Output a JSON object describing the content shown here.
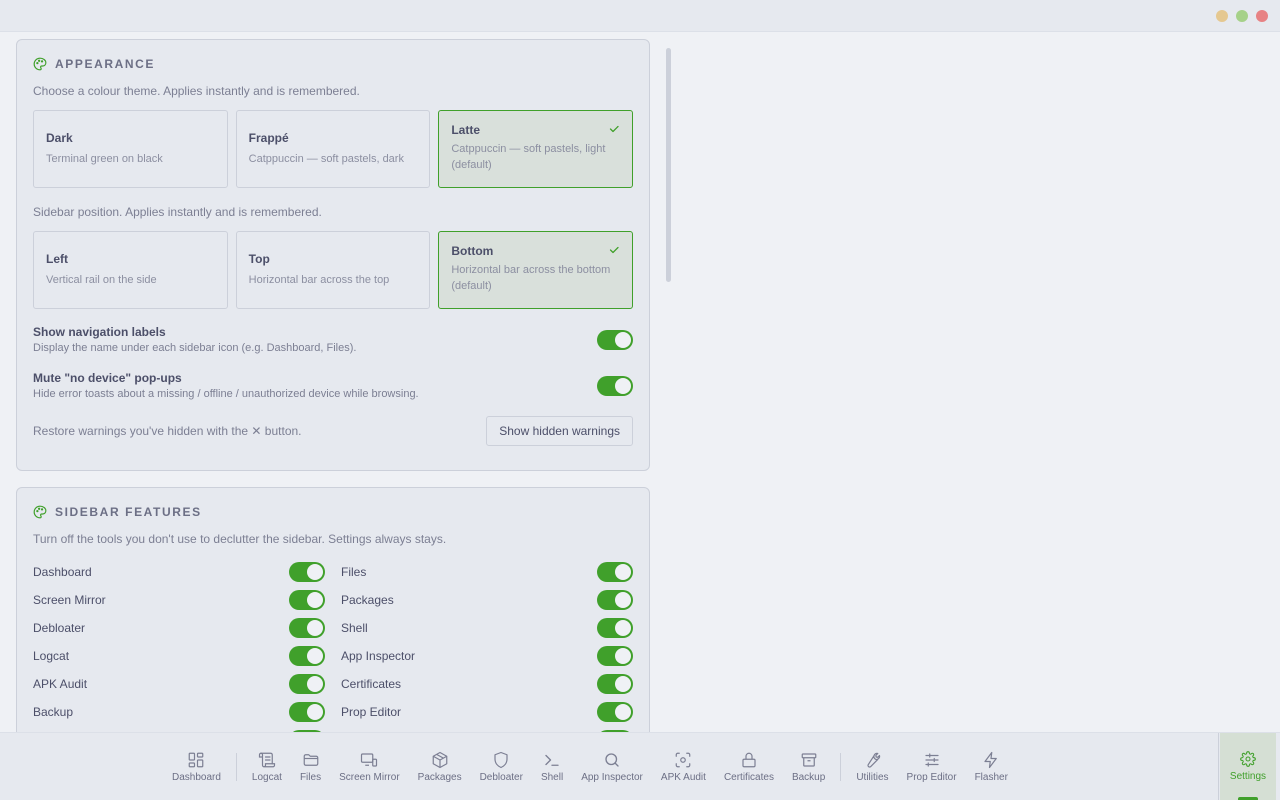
{
  "window_controls": {
    "colors": [
      "#e5c890",
      "#a6d189",
      "#e78284"
    ]
  },
  "colors": {
    "accent": "#40a02b",
    "background": "#eff1f5",
    "card": "#e6e9ef"
  },
  "appearance": {
    "title": "APPEARANCE",
    "icon": "palette-icon",
    "theme_desc": "Choose a colour theme. Applies instantly and is remembered.",
    "themes": [
      {
        "title": "Dark",
        "sub": "Terminal green on black",
        "selected": false
      },
      {
        "title": "Frappé",
        "sub": "Catppuccin — soft pastels, dark",
        "selected": false
      },
      {
        "title": "Latte",
        "sub": "Catppuccin — soft pastels, light (default)",
        "selected": true
      }
    ],
    "sidebar_desc": "Sidebar position. Applies instantly and is remembered.",
    "positions": [
      {
        "title": "Left",
        "sub": "Vertical rail on the side",
        "selected": false
      },
      {
        "title": "Top",
        "sub": "Horizontal bar across the top",
        "selected": false
      },
      {
        "title": "Bottom",
        "sub": "Horizontal bar across the bottom (default)",
        "selected": true
      }
    ],
    "nav_labels": {
      "title": "Show navigation labels",
      "sub": "Display the name under each sidebar icon (e.g. Dashboard, Files).",
      "on": true
    },
    "mute_popups": {
      "title": "Mute \"no device\" pop-ups",
      "sub": "Hide error toasts about a missing / offline / unauthorized device while browsing.",
      "on": true
    },
    "restore_text": "Restore warnings you've hidden with the ✕ button.",
    "restore_button": "Show hidden warnings"
  },
  "sidebar_features": {
    "title": "SIDEBAR FEATURES",
    "icon": "palette-icon",
    "desc": "Turn off the tools you don't use to declutter the sidebar. Settings always stays.",
    "left": [
      {
        "label": "Dashboard",
        "on": true
      },
      {
        "label": "Screen Mirror",
        "on": true
      },
      {
        "label": "Debloater",
        "on": true
      },
      {
        "label": "Logcat",
        "on": true
      },
      {
        "label": "APK Audit",
        "on": true
      },
      {
        "label": "Backup",
        "on": true
      }
    ],
    "right": [
      {
        "label": "Files",
        "on": true
      },
      {
        "label": "Packages",
        "on": true
      },
      {
        "label": "Shell",
        "on": true
      },
      {
        "label": "App Inspector",
        "on": true
      },
      {
        "label": "Certificates",
        "on": true
      },
      {
        "label": "Prop Editor",
        "on": true
      }
    ]
  },
  "nav": {
    "items": [
      {
        "label": "Dashboard",
        "icon": "dashboard-icon"
      },
      {
        "label": "Logcat",
        "icon": "scroll-icon"
      },
      {
        "label": "Files",
        "icon": "folder-icon"
      },
      {
        "label": "Screen Mirror",
        "icon": "monitor-icon"
      },
      {
        "label": "Packages",
        "icon": "package-icon"
      },
      {
        "label": "Debloater",
        "icon": "shield-icon"
      },
      {
        "label": "Shell",
        "icon": "terminal-icon"
      },
      {
        "label": "App Inspector",
        "icon": "search-icon"
      },
      {
        "label": "APK Audit",
        "icon": "scan-icon"
      },
      {
        "label": "Certificates",
        "icon": "lock-icon"
      },
      {
        "label": "Backup",
        "icon": "archive-icon"
      },
      {
        "label": "Utilities",
        "icon": "wrench-icon"
      },
      {
        "label": "Prop Editor",
        "icon": "sliders-icon"
      },
      {
        "label": "Flasher",
        "icon": "lightning-icon"
      }
    ],
    "settings": {
      "label": "Settings",
      "icon": "gear-icon"
    }
  }
}
